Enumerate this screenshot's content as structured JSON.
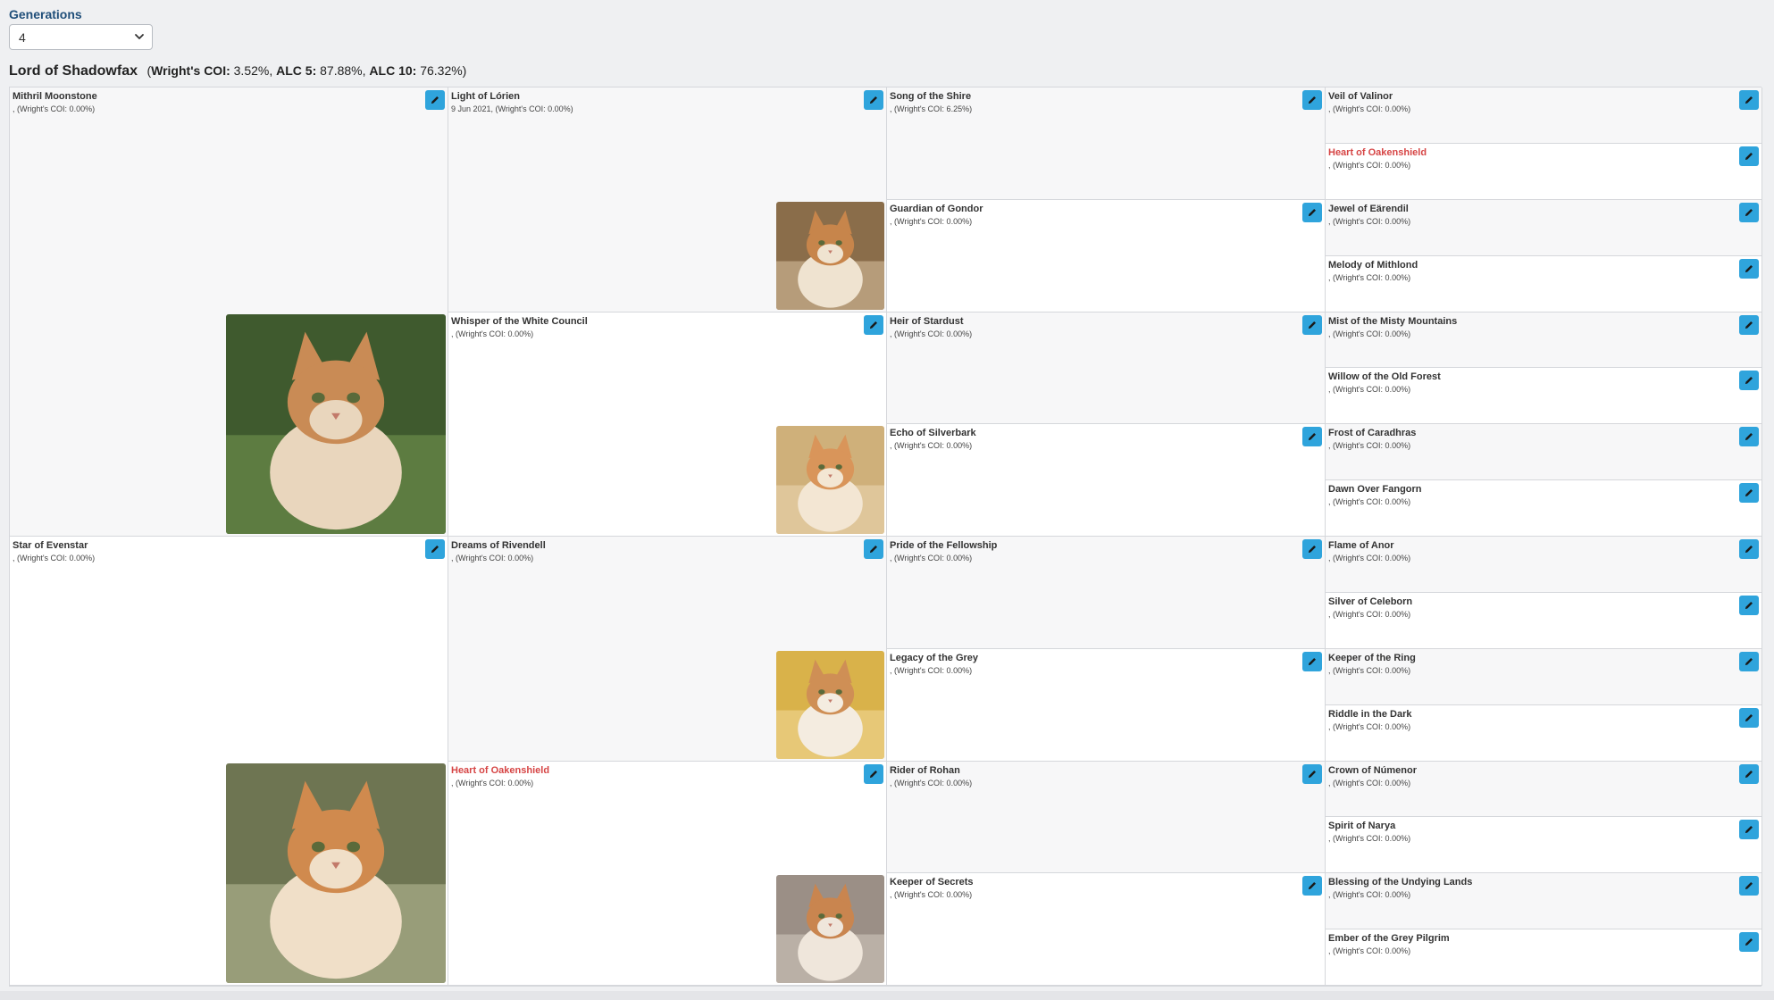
{
  "generations": {
    "label": "Generations",
    "selected": "4"
  },
  "subject": {
    "name": "Lord of Shadowfax",
    "stats_open": "(",
    "coi_label": "Wright's COI:",
    "coi_value": " 3.52%, ",
    "alc5_label": "ALC 5:",
    "alc5_value": " 87.88%, ",
    "alc10_label": "ALC 10:",
    "alc10_value": " 76.32%)"
  },
  "tree": {
    "g1": [
      {
        "name": "Mithril Moonstone",
        "info": ", (Wright's COI: 0.00%)",
        "highlight": false,
        "photo": "cat-photo"
      },
      {
        "name": "Star of Evenstar",
        "info": ", (Wright's COI: 0.00%)",
        "highlight": false,
        "photo": "cat-photo"
      }
    ],
    "g2": [
      {
        "name": "Light of Lórien",
        "info": "9 Jun 2021, (Wright's COI: 0.00%)",
        "highlight": false,
        "photo": "cat-photo"
      },
      {
        "name": "Whisper of the White Council",
        "info": ", (Wright's COI: 0.00%)",
        "highlight": false,
        "photo": "cat-photo"
      },
      {
        "name": "Dreams of Rivendell",
        "info": ", (Wright's COI: 0.00%)",
        "highlight": false,
        "photo": "cat-photo"
      },
      {
        "name": "Heart of Oakenshield",
        "info": ", (Wright's COI: 0.00%)",
        "highlight": true,
        "photo": "cat-photo"
      }
    ],
    "g3": [
      {
        "name": "Song of the Shire",
        "info": ", (Wright's COI: 6.25%)",
        "highlight": false
      },
      {
        "name": "Guardian of Gondor",
        "info": ", (Wright's COI: 0.00%)",
        "highlight": false
      },
      {
        "name": "Heir of Stardust",
        "info": ", (Wright's COI: 0.00%)",
        "highlight": false
      },
      {
        "name": "Echo of Silverbark",
        "info": ", (Wright's COI: 0.00%)",
        "highlight": false
      },
      {
        "name": "Pride of the Fellowship",
        "info": ", (Wright's COI: 0.00%)",
        "highlight": false
      },
      {
        "name": "Legacy of the Grey",
        "info": ", (Wright's COI: 0.00%)",
        "highlight": false
      },
      {
        "name": "Rider of Rohan",
        "info": ", (Wright's COI: 0.00%)",
        "highlight": false
      },
      {
        "name": "Keeper of Secrets",
        "info": ", (Wright's COI: 0.00%)",
        "highlight": false
      }
    ],
    "g4": [
      {
        "name": "Veil of Valinor",
        "info": ", (Wright's COI: 0.00%)",
        "highlight": false
      },
      {
        "name": "Heart of Oakenshield",
        "info": ", (Wright's COI: 0.00%)",
        "highlight": true
      },
      {
        "name": "Jewel of Eärendil",
        "info": ", (Wright's COI: 0.00%)",
        "highlight": false
      },
      {
        "name": "Melody of Mithlond",
        "info": ", (Wright's COI: 0.00%)",
        "highlight": false
      },
      {
        "name": "Mist of the Misty Mountains",
        "info": ", (Wright's COI: 0.00%)",
        "highlight": false
      },
      {
        "name": "Willow of the Old Forest",
        "info": ", (Wright's COI: 0.00%)",
        "highlight": false
      },
      {
        "name": "Frost of Caradhras",
        "info": ", (Wright's COI: 0.00%)",
        "highlight": false
      },
      {
        "name": "Dawn Over Fangorn",
        "info": ", (Wright's COI: 0.00%)",
        "highlight": false
      },
      {
        "name": "Flame of Anor",
        "info": ", (Wright's COI: 0.00%)",
        "highlight": false
      },
      {
        "name": "Silver of Celeborn",
        "info": ", (Wright's COI: 0.00%)",
        "highlight": false
      },
      {
        "name": "Keeper of the Ring",
        "info": ", (Wright's COI: 0.00%)",
        "highlight": false
      },
      {
        "name": "Riddle in the Dark",
        "info": ", (Wright's COI: 0.00%)",
        "highlight": false
      },
      {
        "name": "Crown of Númenor",
        "info": ", (Wright's COI: 0.00%)",
        "highlight": false
      },
      {
        "name": "Spirit of Narya",
        "info": ", (Wright's COI: 0.00%)",
        "highlight": false
      },
      {
        "name": "Blessing of the Undying Lands",
        "info": ", (Wright's COI: 0.00%)",
        "highlight": false
      },
      {
        "name": "Ember of the Grey Pilgrim",
        "info": ", (Wright's COI: 0.00%)",
        "highlight": false
      }
    ]
  },
  "icons": {
    "edit": "pencil-icon",
    "dropdown": "chevron-down-icon",
    "photo": "cat-photo"
  },
  "colors": {
    "accent": "#2fa4dc",
    "highlight": "#d64545",
    "heading": "#1f4e79"
  }
}
